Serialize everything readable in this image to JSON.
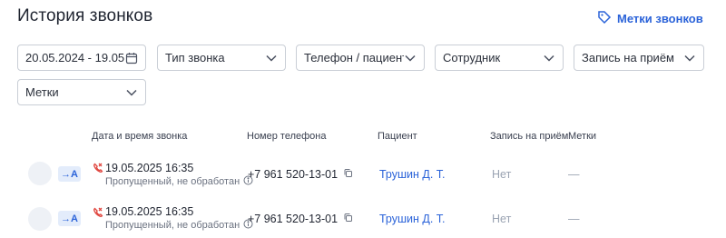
{
  "header": {
    "title": "История звонков",
    "tags_link_label": "Метки звонков",
    "tags_link_icon": "tag-icon"
  },
  "filters": {
    "date_range": "20.05.2024 - 19.05.2025",
    "call_type": "Тип звонка",
    "phone_patient": "Телефон / пациент",
    "employee": "Сотрудник",
    "appointment": "Запись на приём",
    "tags": "Метки"
  },
  "table": {
    "columns": [
      "Дата и время звонка",
      "Номер телефона",
      "Пациент",
      "Запись на приём",
      "Метки"
    ],
    "rows": [
      {
        "direction": "→A",
        "datetime": "19.05.2025 16:35",
        "status": "Пропущенный, не обработан",
        "phone": "+7 961 520-13-01",
        "patient": "Трушин Д. Т.",
        "appointment": "Нет",
        "tags": "—"
      },
      {
        "direction": "→A",
        "datetime": "19.05.2025 16:35",
        "status": "Пропущенный, не обработан",
        "phone": "+7 961 520-13-01",
        "patient": "Трушин Д. Т.",
        "appointment": "Нет",
        "tags": "—"
      }
    ]
  },
  "colors": {
    "accent": "#2b63d9",
    "missed": "#e0463f",
    "muted": "#9aa3b2"
  }
}
